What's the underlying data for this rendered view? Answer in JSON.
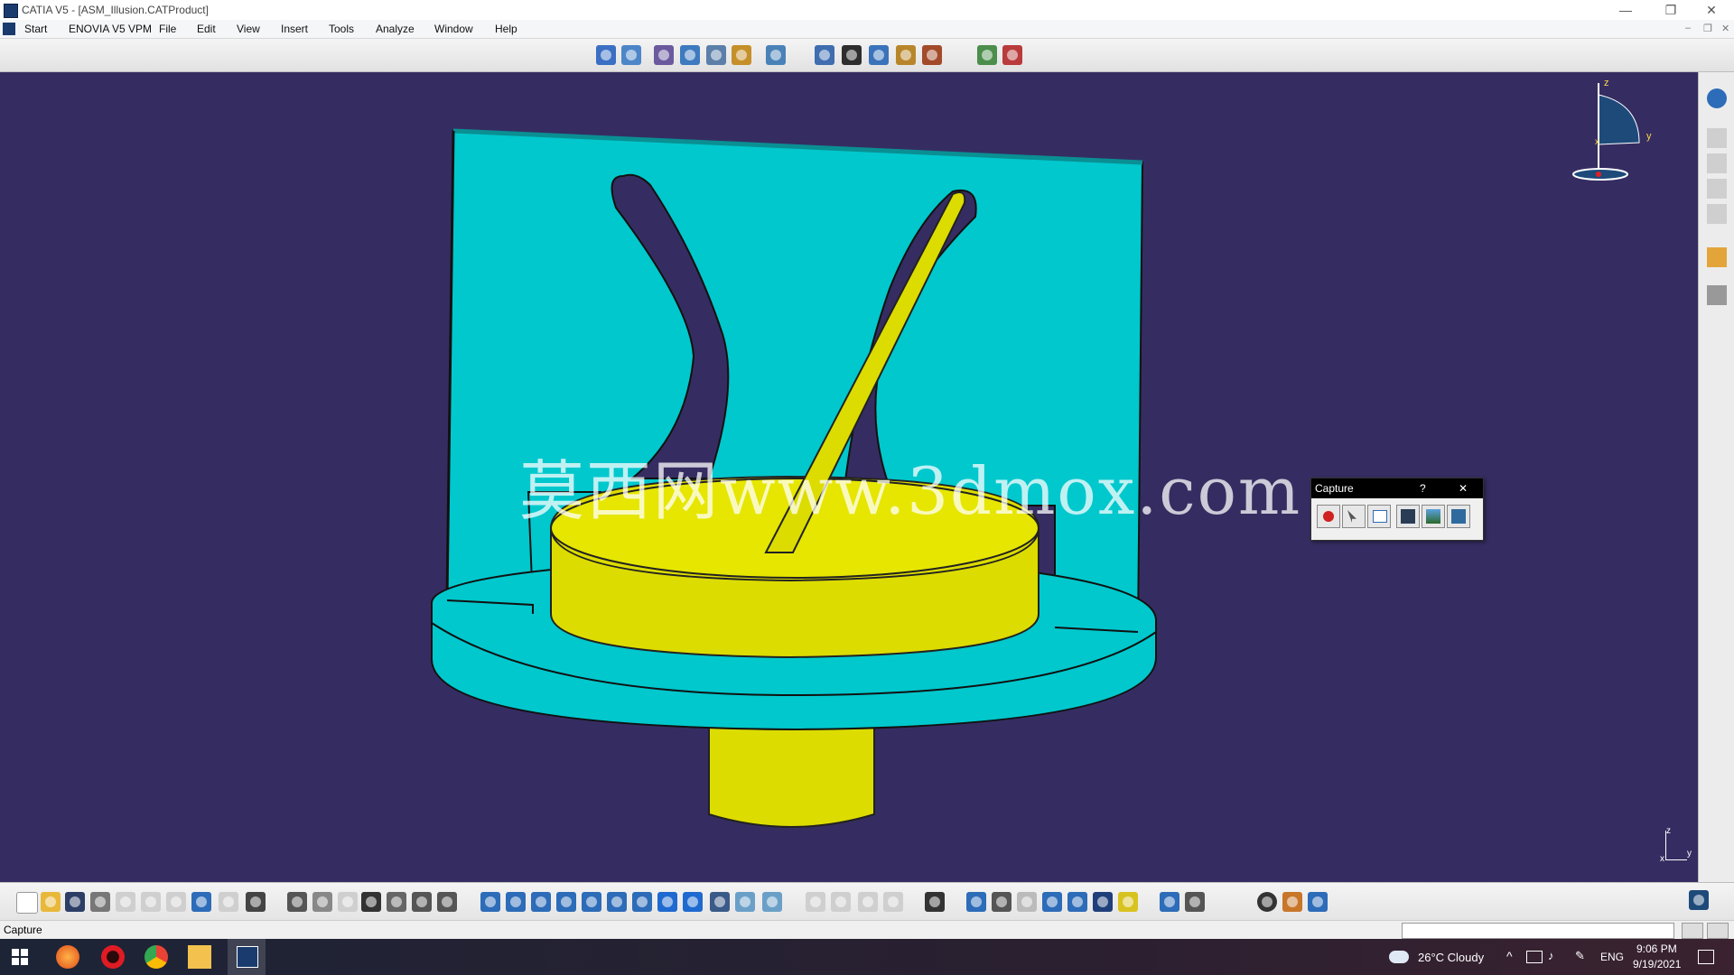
{
  "window": {
    "title": "CATIA V5 - [ASM_Illusion.CATProduct]",
    "min_glyph": "—",
    "restore_glyph": "❐",
    "close_glyph": "✕"
  },
  "menu": {
    "items": [
      "Start",
      "ENOVIA V5 VPM",
      "File",
      "Edit",
      "View",
      "Insert",
      "Tools",
      "Analyze",
      "Window",
      "Help"
    ],
    "mdi": [
      "–",
      "❐",
      "✕"
    ]
  },
  "viewport": {
    "watermark": "莫西网www.3dmox.com",
    "colors": {
      "background": "#352d61",
      "cyan_part": "#00c8cd",
      "yellow_part": "#dcdc00"
    },
    "compass_labels": {
      "z": "z",
      "y": "y",
      "x": "x"
    },
    "axis_labels": {
      "z": "z",
      "x": "x",
      "y": "y"
    }
  },
  "capture_dialog": {
    "title": "Capture",
    "help": "?",
    "close": "✕",
    "tools": [
      "record-icon",
      "select-icon",
      "options-icon",
      "render-icon",
      "image-icon",
      "album-icon"
    ]
  },
  "toolbar_icons": {
    "top": [
      "fly-mode-icon",
      "walk-icon",
      "rotate-icon",
      "pan-icon",
      "zoom-area-icon",
      "normal-view-icon",
      "view-icon",
      "lookat-icon",
      "film-icon",
      "camera-icon",
      "render-icon",
      "tools-icon",
      "catalog-icon",
      "apply-material-icon"
    ],
    "bottom": [
      "new-icon",
      "open-icon",
      "save-icon",
      "print-icon",
      "cut-icon",
      "copy-icon",
      "paste-icon",
      "undo-icon",
      "redo-icon",
      "whats-this-icon",
      "formula-icon",
      "comment-icon",
      "measure-icon",
      "table-icon",
      "constraints-icon",
      "snap-icon",
      "catalog-icon",
      "fly-icon",
      "fit-all-icon",
      "pan-icon",
      "rotate-icon",
      "zoom-in-icon",
      "zoom-out-icon",
      "normal-view-icon",
      "multi-view-icon",
      "iso-view-icon",
      "shading-icon",
      "hide-show-icon",
      "swap-space-icon",
      "camera-icon",
      "compass-icon",
      "previous-icon",
      "next-icon",
      "search-icon",
      "filter-icon",
      "colors-icon",
      "lighting-icon",
      "manipulate-icon",
      "explode-icon",
      "update-icon",
      "settings-icon",
      "catia-logo-icon"
    ]
  },
  "statusbar": {
    "text": "Capture"
  },
  "taskbar": {
    "weather": "26°C  Cloudy",
    "lang": "ENG",
    "time": "9:06 PM",
    "date": "9/19/2021"
  }
}
